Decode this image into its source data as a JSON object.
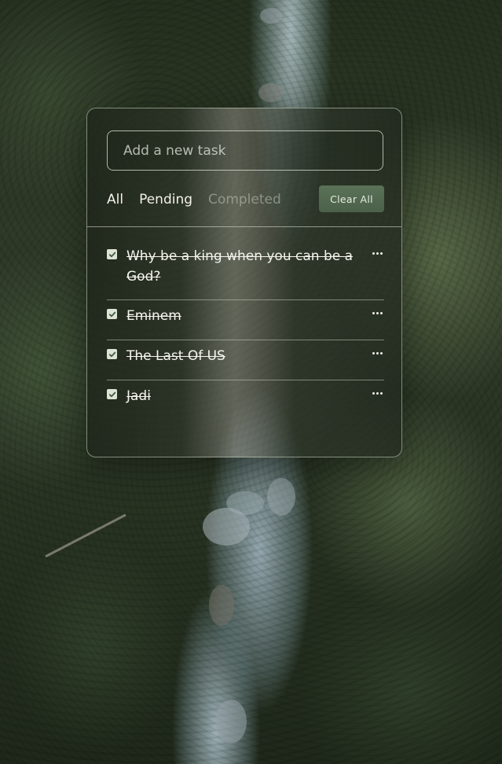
{
  "input": {
    "placeholder": "Add a new task",
    "value": ""
  },
  "filters": {
    "all": "All",
    "pending": "Pending",
    "completed": "Completed",
    "active": "completed"
  },
  "clear_all_label": "Clear All",
  "tasks": [
    {
      "text": "Why be a king when you can be a God?",
      "completed": true
    },
    {
      "text": "Eminem",
      "completed": true
    },
    {
      "text": "The Last Of US",
      "completed": true
    },
    {
      "text": "Jadi",
      "completed": true
    }
  ],
  "colors": {
    "accent_button": "#4f6a4d",
    "card_border": "#d2dcc8"
  }
}
